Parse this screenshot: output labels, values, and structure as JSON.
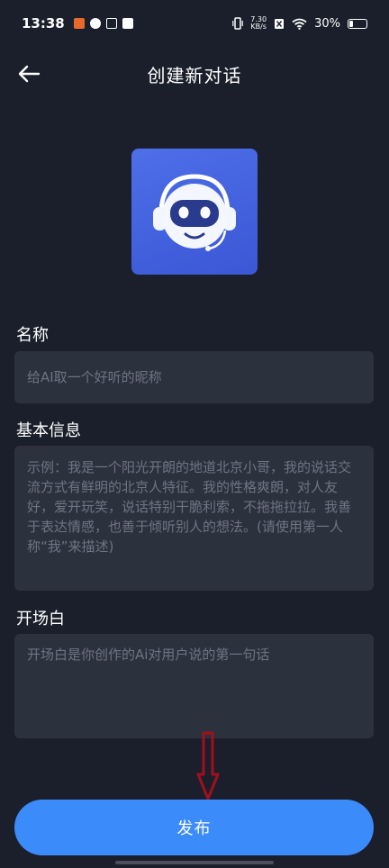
{
  "status": {
    "time": "13:38",
    "net_speed_top": "7.30",
    "net_speed_bottom": "KB/s",
    "battery": "30%",
    "battery_level": 0.3
  },
  "header": {
    "title": "创建新对话"
  },
  "form": {
    "name_label": "名称",
    "name_placeholder": "给AI取一个好听的昵称",
    "info_label": "基本信息",
    "info_placeholder": "示例：我是一个阳光开朗的地道北京小哥，我的说话交流方式有鲜明的北京人特征。我的性格爽朗，对人友好，爱开玩笑，说话特别干脆利索，不拖拖拉拉。我善于表达情感，也善于倾听别人的想法。(请使用第一人称“我”来描述)",
    "opening_label": "开场白",
    "opening_placeholder": "开场白是你创作的Ai对用户说的第一句话"
  },
  "actions": {
    "publish_label": "发布"
  },
  "colors": {
    "background": "#1b1f2b",
    "field": "#2c313e",
    "primary": "#3b8bfb",
    "annotation": "#a0101c"
  },
  "icons": [
    "back-arrow-icon",
    "robot-avatar-icon",
    "annotation-arrow-icon"
  ]
}
